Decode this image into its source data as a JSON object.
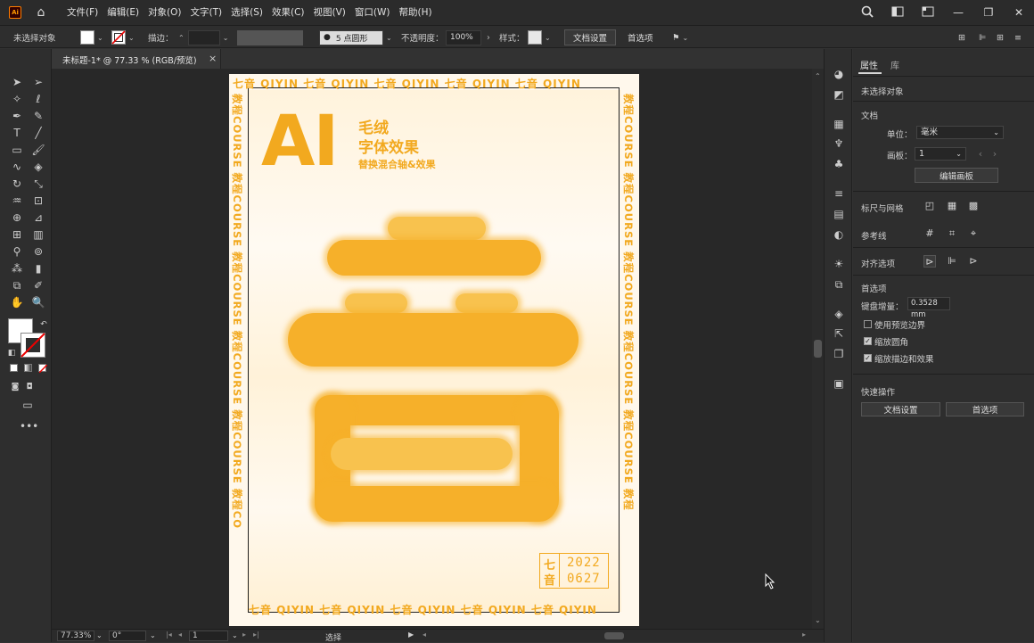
{
  "menubar": {
    "app_logo": "Ai",
    "items": [
      "文件(F)",
      "编辑(E)",
      "对象(O)",
      "文字(T)",
      "选择(S)",
      "效果(C)",
      "视图(V)",
      "窗口(W)",
      "帮助(H)"
    ],
    "window_controls": [
      "—",
      "❐",
      "✕"
    ]
  },
  "controlbar": {
    "selection_status": "未选择对象",
    "stroke_label": "描边：",
    "brush_label": "5 点圆形",
    "opacity_label": "不透明度：",
    "opacity_value": "100%",
    "style_label": "样式：",
    "doc_setup_button": "文档设置",
    "prefs_button": "首选项"
  },
  "document": {
    "tab_title": "未标题-1* @ 77.33 % (RGB/预览)",
    "close_glyph": "×"
  },
  "artwork": {
    "big_title": "AI",
    "subtitle_line1": "毛绒",
    "subtitle_line2": "字体效果",
    "tagline": "替换混合轴&效果",
    "border_top": "七音 QIYIN 七音 QIYIN 七音 QIYIN 七音 QIYIN 七音 QIYIN",
    "border_bottom": "七音 QIYIN 七音 QIYIN 七音 QIYIN 七音 QIYIN 七音 QIYIN",
    "border_left": "教程COURSE 教程COURSE 教程COURSE 教程COURSE 教程COURSE 教程CO",
    "border_right": "教程COURSE 教程COURSE 教程COURSE 教程COURSE 教程COURSE 教程",
    "stamp_char1": "七",
    "stamp_char2": "音",
    "stamp_year": "2022",
    "stamp_date": "0627",
    "accent_color": "#f2a91f"
  },
  "properties": {
    "tab_properties": "属性",
    "tab_library": "库",
    "no_selection": "未选择对象",
    "section_document": "文档",
    "units_label": "单位：",
    "units_value": "毫米",
    "artboard_label": "画板：",
    "artboard_value": "1",
    "edit_artboards_button": "编辑画板",
    "rulers_grids": "标尺与网格",
    "guides": "参考线",
    "snap_options": "对齐选项",
    "section_prefs": "首选项",
    "keyboard_increment_label": "键盘增量：",
    "keyboard_increment_value": "0.3528 mm",
    "use_preview_bounds": "使用预览边界",
    "scale_corners": "缩放圆角",
    "scale_strokes_effects": "缩放描边和效果",
    "quick_actions": "快速操作",
    "doc_setup_button": "文档设置",
    "prefs_button": "首选项"
  },
  "statusbar": {
    "zoom": "77.33%",
    "rotation": "0°",
    "artboard_nav": "1",
    "tool_name": "选择"
  }
}
